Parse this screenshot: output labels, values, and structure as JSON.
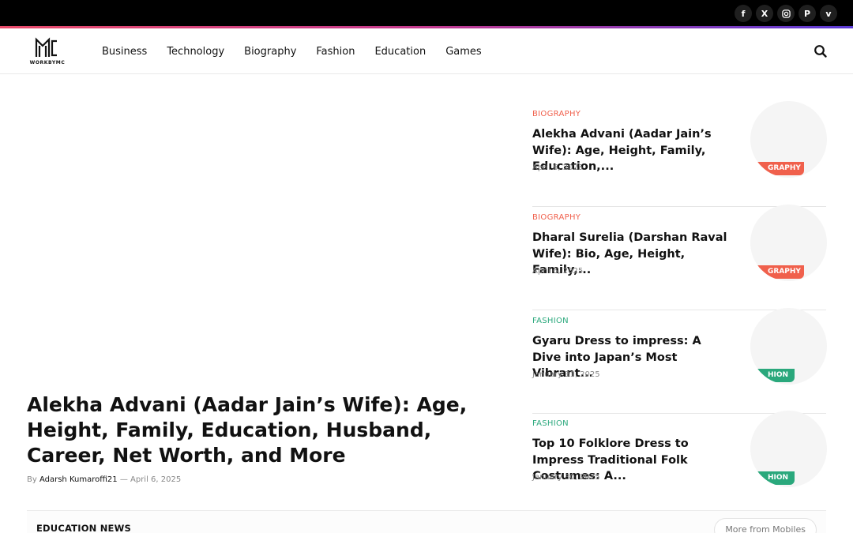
{
  "topbar": {
    "socials": [
      {
        "icon": "facebook-icon",
        "glyph": "f"
      },
      {
        "icon": "x-icon",
        "glyph": "X"
      },
      {
        "icon": "instagram-icon",
        "glyph": "◎"
      },
      {
        "icon": "pinterest-icon",
        "glyph": "P"
      },
      {
        "icon": "vimeo-icon",
        "glyph": "v"
      }
    ]
  },
  "header": {
    "logo_text": "WORKBYMC",
    "nav": [
      "Business",
      "Technology",
      "Biography",
      "Fashion",
      "Education",
      "Games"
    ]
  },
  "hero": {
    "title": "Alekha Advani (Aadar Jain’s Wife): Age, Height, Family, Education, Husband, Career, Net Worth, and More",
    "by": "By",
    "author": "Adarsh Kumaroffi21",
    "sep": "—",
    "date": "April 6, 2025"
  },
  "posts": [
    {
      "category": "BIOGRAPHY",
      "title": "Alekha Advani (Aadar Jain’s Wife): Age, Height, Family, Education,...",
      "date": "April 6, 2025",
      "badge": "GRAPHY"
    },
    {
      "category": "BIOGRAPHY",
      "title": "Dharal Surelia (Darshan Raval Wife): Bio, Age, Height, Family,...",
      "date": "April 6, 2025",
      "badge": "GRAPHY"
    },
    {
      "category": "FASHION",
      "title": "Gyaru Dress to impress: A Dive into Japan’s Most Vibrant...",
      "date": "January 31, 2025",
      "badge": "HION"
    },
    {
      "category": "FASHION",
      "title": "Top 10 Folklore Dress to Impress Traditional Folk Costumes: A...",
      "date": "January 30, 2025",
      "badge": "HION"
    }
  ],
  "colors": {
    "biography": "#f0604c",
    "fashion": "#2aa87c"
  },
  "section": {
    "title": "EDUCATION NEWS",
    "more": "More from Mobiles"
  }
}
